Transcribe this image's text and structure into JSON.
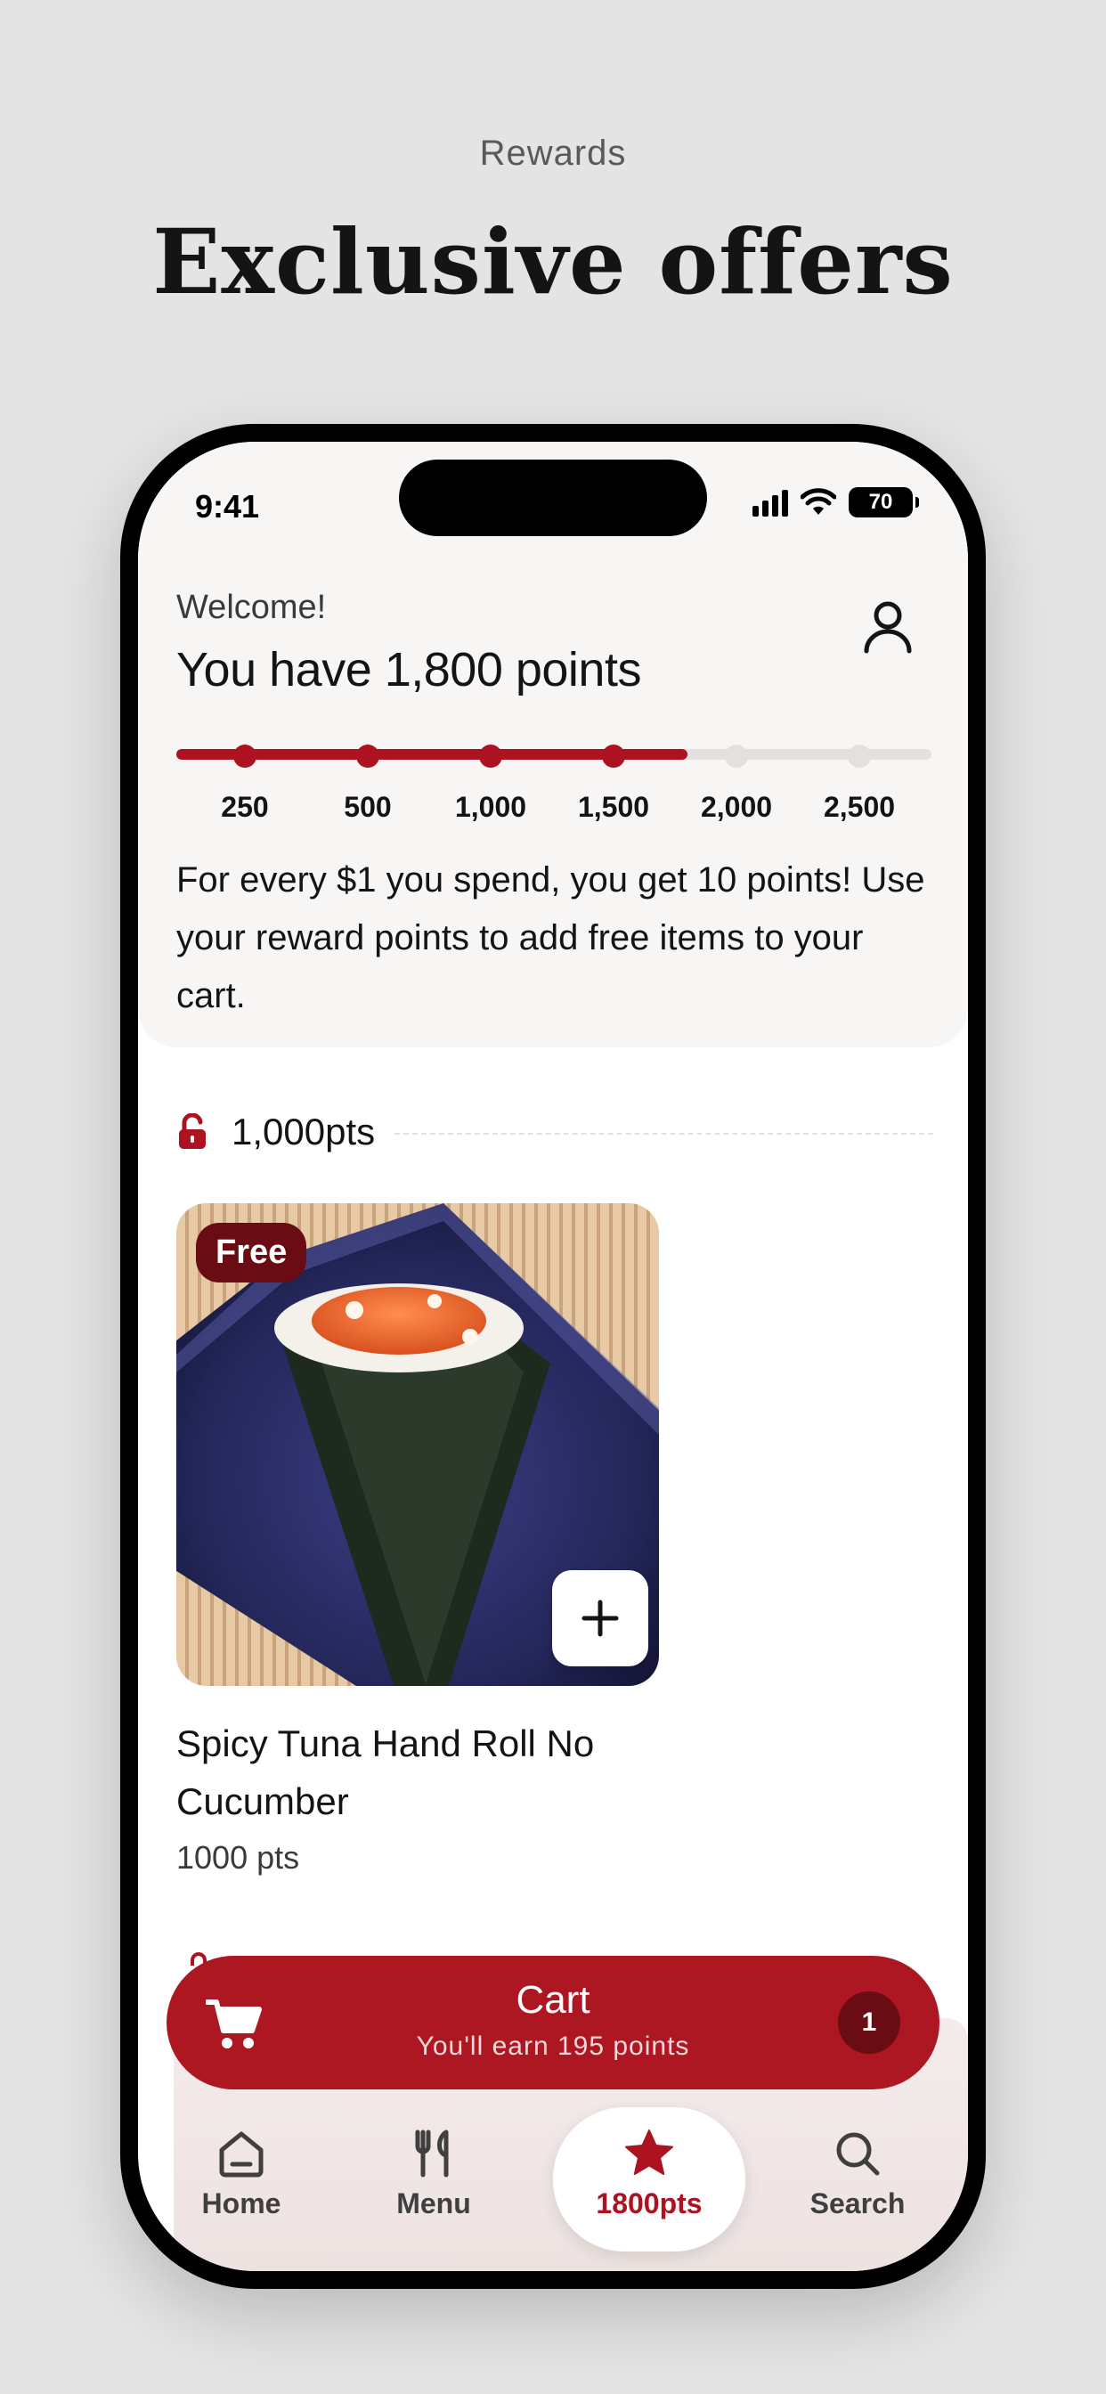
{
  "page": {
    "eyebrow": "Rewards",
    "title": "Exclusive offers"
  },
  "status_bar": {
    "time": "9:41",
    "battery": "70"
  },
  "header": {
    "welcome": "Welcome!",
    "points_heading": "You have 1,800 points",
    "profile_icon": "person-icon",
    "current_points": 1800,
    "milestones": [
      "250",
      "500",
      "1,000",
      "1,500",
      "2,000",
      "2,500"
    ],
    "info_text": "For every $1 you spend, you get 10 points! Use your reward points to add free items to your cart.",
    "accent_color": "#ad1220",
    "track_color": "#e6dfdf"
  },
  "tier": {
    "icon": "unlocked-lock-icon",
    "label": "1,000pts"
  },
  "reward_item": {
    "badge": "Free",
    "name": "Spicy Tuna Hand Roll No Cucumber",
    "points": "1000 pts",
    "add_icon": "plus-icon"
  },
  "cart": {
    "title": "Cart",
    "subtitle": "You'll earn 195 points",
    "count": "1",
    "icon": "cart-icon",
    "color": "#ad1722"
  },
  "tabbar": {
    "items": [
      {
        "label": "Home",
        "icon": "home-icon"
      },
      {
        "label": "Menu",
        "icon": "fork-knife-icon"
      },
      {
        "label": "1800pts",
        "icon": "star-icon",
        "active": true
      },
      {
        "label": "Search",
        "icon": "search-icon"
      }
    ]
  }
}
